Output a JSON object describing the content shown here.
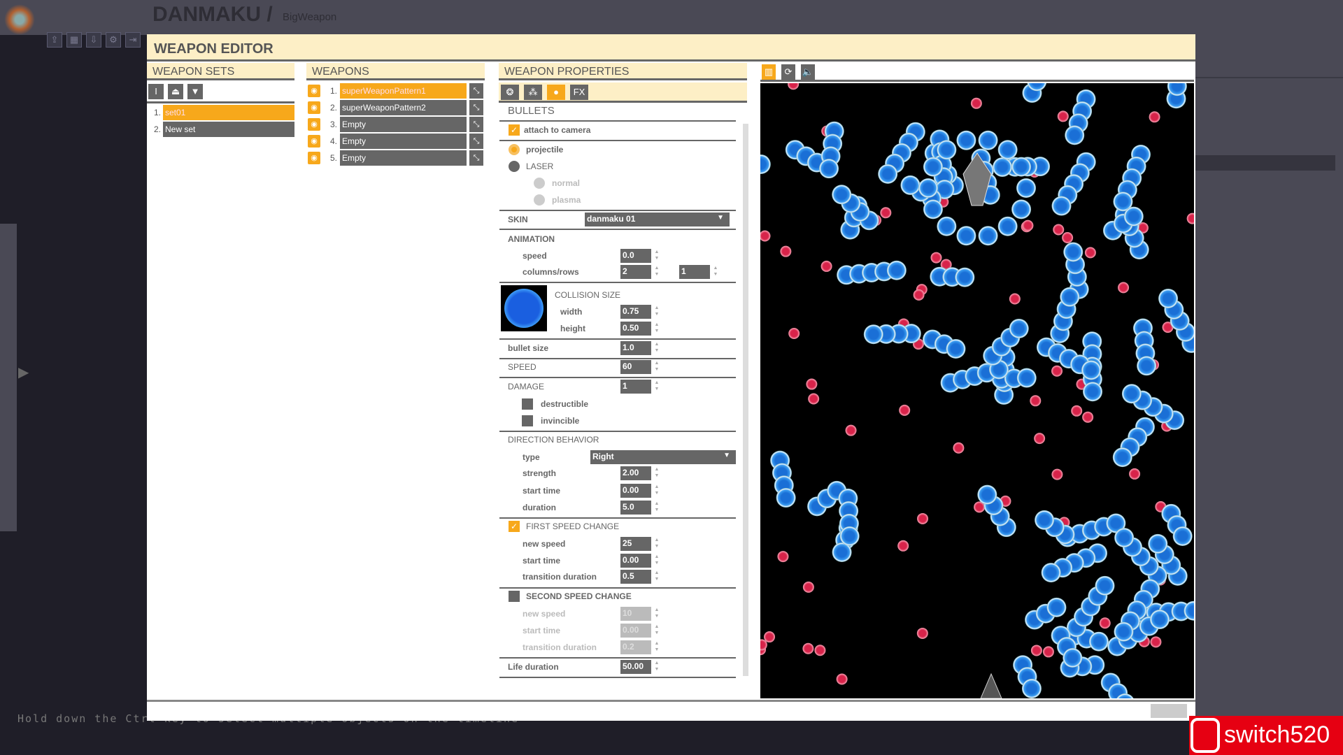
{
  "app": {
    "title": "DANMAKU /",
    "project": "BigWeapon",
    "toolbar_icons": [
      "export-icon",
      "grid-icon",
      "import-icon",
      "gear-icon",
      "exit-icon"
    ]
  },
  "editor": {
    "title": "WEAPON EDITOR"
  },
  "weapon_sets": {
    "header": "WEAPON SETS",
    "tools": [
      "rename-icon",
      "move-up-icon",
      "move-down-icon"
    ],
    "items": [
      {
        "num": "1.",
        "label": "set01",
        "selected": true
      },
      {
        "num": "2.",
        "label": "New set",
        "selected": false
      }
    ]
  },
  "weapons": {
    "header": "WEAPONS",
    "items": [
      {
        "num": "1.",
        "label": "superWeaponPattern1",
        "selected": true
      },
      {
        "num": "2.",
        "label": "superWeaponPattern2",
        "selected": false
      },
      {
        "num": "3.",
        "label": "Empty",
        "selected": false
      },
      {
        "num": "4.",
        "label": "Empty",
        "selected": false
      },
      {
        "num": "5.",
        "label": "Empty",
        "selected": false
      }
    ]
  },
  "properties": {
    "header": "WEAPON PROPERTIES",
    "tabs": [
      "emitter-icon",
      "pattern-icon",
      "bullet-icon",
      "FX"
    ],
    "active_tab": 2,
    "section": "BULLETS",
    "attach_to_camera": {
      "label": "attach to camera",
      "checked": true
    },
    "type_projectile": "projectile",
    "type_laser": "LASER",
    "laser_normal": "normal",
    "laser_plasma": "plasma",
    "skin": {
      "label": "SKIN",
      "value": "danmaku 01"
    },
    "animation": {
      "label": "ANIMATION",
      "speed_label": "speed",
      "speed": "0.0",
      "colrows_label": "columns/rows",
      "columns": "2",
      "rows": "1"
    },
    "collision": {
      "label": "COLLISION SIZE",
      "width_label": "width",
      "width": "0.75",
      "height_label": "height",
      "height": "0.50"
    },
    "bullet_size": {
      "label": "bullet size",
      "value": "1.0"
    },
    "speed": {
      "label": "SPEED",
      "value": "60"
    },
    "damage": {
      "label": "DAMAGE",
      "value": "1",
      "destructible": "destructible",
      "invincible": "invincible"
    },
    "direction": {
      "label": "DIRECTION BEHAVIOR",
      "type_label": "type",
      "type": "Right",
      "strength_label": "strength",
      "strength": "2.00",
      "start_label": "start time",
      "start": "0.00",
      "duration_label": "duration",
      "duration": "5.0"
    },
    "first_speed": {
      "label": "FIRST SPEED CHANGE",
      "checked": true,
      "new_speed_label": "new speed",
      "new_speed": "25",
      "start_label": "start time",
      "start": "0.00",
      "trans_label": "transition duration",
      "trans": "0.5"
    },
    "second_speed": {
      "label": "SECOND SPEED CHANGE",
      "checked": false,
      "new_speed_label": "new speed",
      "new_speed": "10",
      "start_label": "start time",
      "start": "0.00",
      "trans_label": "transition duration",
      "trans": "0.2"
    },
    "life": {
      "label": "Life duration",
      "value": "50.00"
    }
  },
  "preview": {
    "tools": [
      "layout-icon",
      "refresh-icon",
      "sound-icon"
    ]
  },
  "hint": "Hold down the Ctrl key to select multiple objects on the timeline",
  "watermark": "switch520",
  "colors": {
    "accent": "#f7a81b",
    "header_bg": "#fdefc6",
    "control": "#666666",
    "bullet_blue": "#1a6fd6",
    "bullet_red": "#d8234a"
  }
}
